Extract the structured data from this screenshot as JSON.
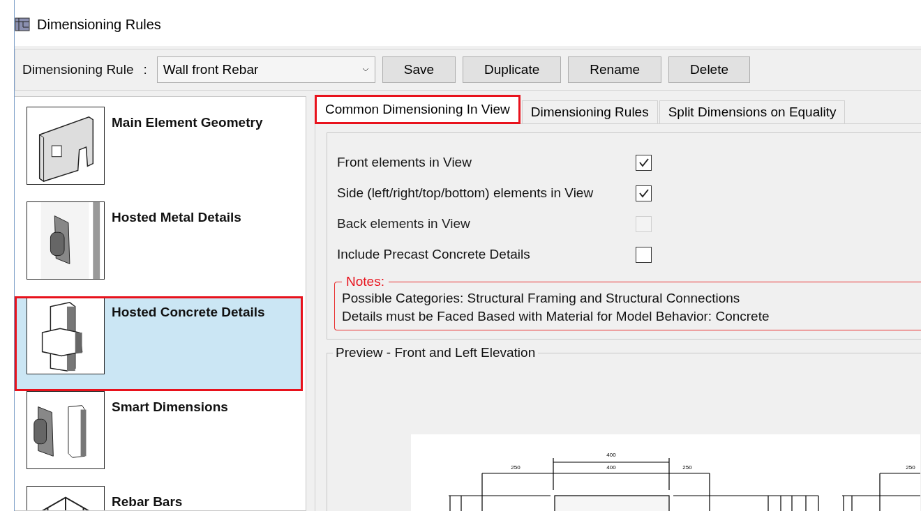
{
  "window": {
    "title": "Dimensioning Rules"
  },
  "toolbar": {
    "label": "Dimensioning Rule",
    "separator": ":",
    "rule": "Wall front Rebar",
    "buttons": [
      "Save",
      "Duplicate",
      "Rename",
      "Delete"
    ]
  },
  "sidebar": {
    "items": [
      {
        "label": "Main Element Geometry",
        "kind": "wall",
        "selected": false
      },
      {
        "label": "Hosted Metal Details",
        "kind": "metal",
        "selected": false
      },
      {
        "label": "Hosted Concrete Details",
        "kind": "concrete",
        "selected": true
      },
      {
        "label": "Smart Dimensions",
        "kind": "smart",
        "selected": false
      },
      {
        "label": "Rebar Bars",
        "kind": "rebar",
        "selected": false
      }
    ]
  },
  "tabs": [
    {
      "label": "Common Dimensioning In View",
      "selected": true
    },
    {
      "label": "Dimensioning Rules",
      "selected": false
    },
    {
      "label": "Split Dimensions on Equality",
      "selected": false
    }
  ],
  "options": [
    {
      "label": "Front elements in View",
      "checked": true,
      "disabled": false
    },
    {
      "label": "Side (left/right/top/bottom) elements in View",
      "checked": true,
      "disabled": false
    },
    {
      "label": "Back elements in View",
      "checked": false,
      "disabled": true
    },
    {
      "label": "Include Precast Concrete Details",
      "checked": false,
      "disabled": false
    }
  ],
  "notes": {
    "title": "Notes:",
    "lines": [
      "Possible Categories: Structural Framing and Structural Connections",
      "Details must be Faced Based with Material for Model Behavior: Concrete"
    ]
  },
  "preview": {
    "title": "Preview - Front and Left Elevation",
    "dimension_labels": [
      "400",
      "250",
      "400",
      "250",
      "250"
    ]
  }
}
